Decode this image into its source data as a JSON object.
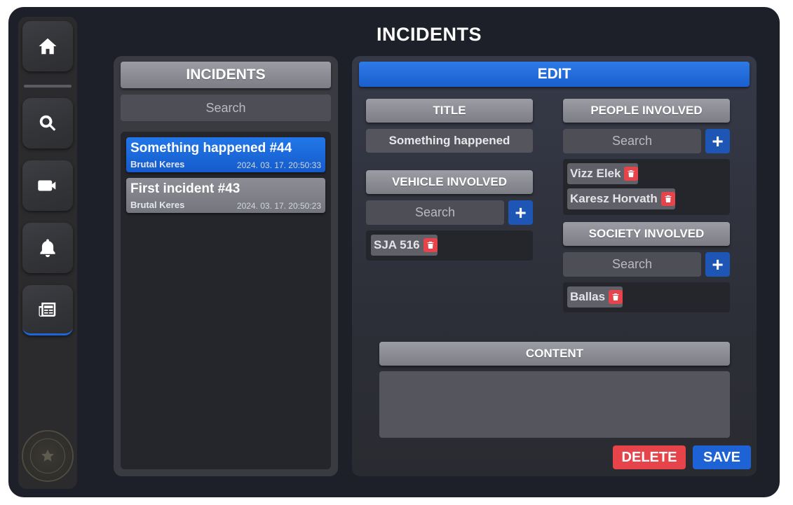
{
  "page": {
    "title": "INCIDENTS"
  },
  "sidebar": {
    "items": [
      {
        "icon": "home-icon"
      },
      {
        "icon": "search-icon"
      },
      {
        "icon": "video-camera-icon"
      },
      {
        "icon": "bell-icon"
      },
      {
        "icon": "newspaper-icon",
        "active": true
      }
    ],
    "seal": "police-department-seal"
  },
  "incidents_panel": {
    "header": "INCIDENTS",
    "search_placeholder": "Search",
    "items": [
      {
        "title": "Something happened #44",
        "author": "Brutal Keres",
        "date": "2024. 03. 17. 20:50:33",
        "active": true
      },
      {
        "title": "First incident #43",
        "author": "Brutal Keres",
        "date": "2024. 03. 17. 20:50:23",
        "active": false
      }
    ]
  },
  "edit_panel": {
    "header": "EDIT",
    "title_section": {
      "label": "TITLE",
      "value": "Something happened"
    },
    "vehicle_section": {
      "label": "VEHICLE INVOLVED",
      "search_placeholder": "Search",
      "tags": [
        "SJA 516"
      ]
    },
    "people_section": {
      "label": "PEOPLE INVOLVED",
      "search_placeholder": "Search",
      "tags": [
        "Vizz Elek",
        "Karesz Horvath"
      ]
    },
    "society_section": {
      "label": "SOCIETY INVOLVED",
      "search_placeholder": "Search",
      "tags": [
        "Ballas"
      ]
    },
    "content_section": {
      "label": "CONTENT",
      "value": ""
    },
    "delete_label": "DELETE",
    "save_label": "SAVE"
  },
  "colors": {
    "accent_blue": "#1e63d6",
    "danger_red": "#e6434a",
    "background": "#1e2029",
    "sidebar": "#2b2b2e"
  }
}
